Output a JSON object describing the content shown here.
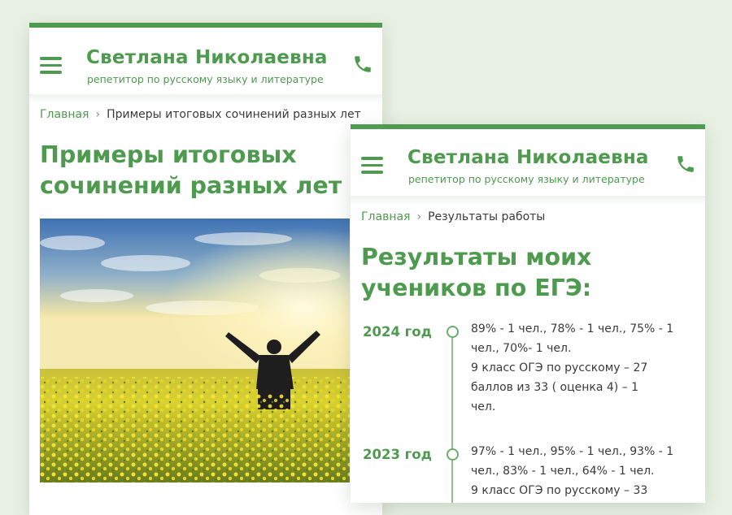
{
  "brand": {
    "name": "Светлана Николаевна",
    "subtitle": "репетитор по русскому языку и литературе"
  },
  "page1": {
    "breadcrumb": {
      "home": "Главная",
      "separator": "›",
      "current": "Примеры итоговых сочинений разных лет"
    },
    "title_line1": "Примеры итоговых",
    "title_line2": "сочинений разных лет"
  },
  "page2": {
    "breadcrumb": {
      "home": "Главная",
      "separator": "›",
      "current": "Результаты работы"
    },
    "title_line1": "Результаты моих",
    "title_line2": "учеников по ЕГЭ:",
    "timeline": [
      {
        "year": "2024 год",
        "lines": [
          "89% - 1 чел., 78% - 1 чел., 75% - 1",
          "чел., 70%- 1 чел.",
          "9 класс ОГЭ по русскому – 27",
          "баллов из 33 ( оценка 4) – 1",
          "чел."
        ]
      },
      {
        "year": "2023 год",
        "lines": [
          "97% - 1 чел., 95% - 1 чел., 93% - 1",
          "чел., 83% - 1 чел., 64% - 1 чел.",
          "9 класс ОГЭ по русскому – 33"
        ]
      }
    ]
  },
  "colors": {
    "accent": "#4e9a4f",
    "background": "#e9f1e4",
    "text": "#3a3a3a"
  },
  "icons": {
    "menu": "hamburger-menu-icon",
    "phone": "phone-icon"
  }
}
